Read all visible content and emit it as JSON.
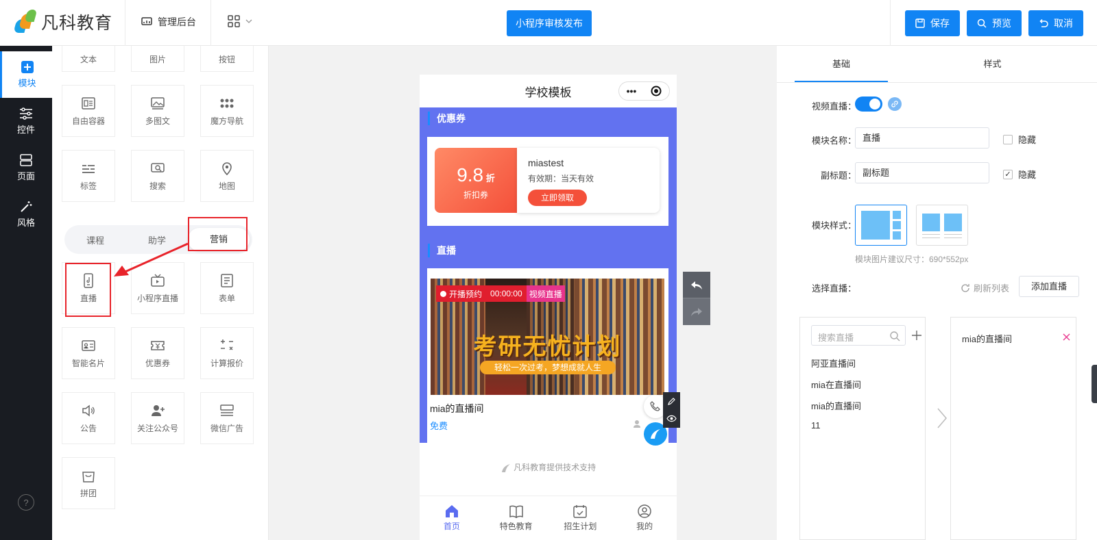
{
  "header": {
    "brand": "凡科教育",
    "admin_label": "管理后台",
    "publish_label": "小程序审核发布",
    "save_label": "保存",
    "preview_label": "预览",
    "cancel_label": "取消"
  },
  "sidenav": {
    "items": [
      "模块",
      "控件",
      "页面",
      "风格"
    ],
    "help": "?"
  },
  "widgets": {
    "row0": [
      "文本",
      "图片",
      "按钮"
    ],
    "row1": [
      "自由容器",
      "多图文",
      "魔方导航"
    ],
    "row2": [
      "标签",
      "搜索",
      "地图"
    ],
    "tabs": [
      "课程",
      "助学",
      "营销"
    ],
    "row3": [
      "直播",
      "小程序直播",
      "表单"
    ],
    "row4": [
      "智能名片",
      "优惠券",
      "计算报价"
    ],
    "row5": [
      "公告",
      "关注公众号",
      "微信广告"
    ],
    "row6": [
      "拼团"
    ]
  },
  "phone": {
    "title": "学校模板",
    "capsule_dots": "•••",
    "coupon_section": "优惠券",
    "coupon": {
      "value": "9.8",
      "unit": "折",
      "type": "折扣券",
      "name": "miastest",
      "validity": "有效期：当天有效",
      "claim": "立即领取"
    },
    "live_section": "直播",
    "live": {
      "tag_status": "开播预约",
      "tag_time": "00:00:00",
      "tag_type": "视频直播",
      "slogan": "考研无忧计划",
      "subslogan": "轻松一次过考，梦想成就人生",
      "name": "mia的直播间",
      "price": "免费"
    },
    "footer": "凡科教育提供技术支持",
    "tabbar": [
      "首页",
      "特色教育",
      "招生计划",
      "我的"
    ]
  },
  "panel": {
    "tabs": [
      "基础",
      "样式"
    ],
    "live_toggle_label": "视频直播：",
    "module_name_label": "模块名称：",
    "module_name_value": "直播",
    "subtitle_label": "副标题：",
    "subtitle_value": "副标题",
    "hide_label": "隐藏",
    "style_label": "模块样式：",
    "size_hint": "模块图片建议尺寸：690*552px",
    "select_label": "选择直播：",
    "refresh_label": "刷新列表",
    "add_label": "添加直播",
    "search_placeholder": "搜索直播",
    "list": [
      "阿亚直播间",
      "mia在直播间",
      "mia的直播间",
      "11"
    ],
    "selected": [
      "mia的直播间"
    ]
  },
  "colors": {
    "accent": "#1184f4",
    "phone_bg": "#6272f0",
    "coupon": "#f4503a",
    "nav_dark": "#191c22",
    "highlight": "#e8232a"
  }
}
